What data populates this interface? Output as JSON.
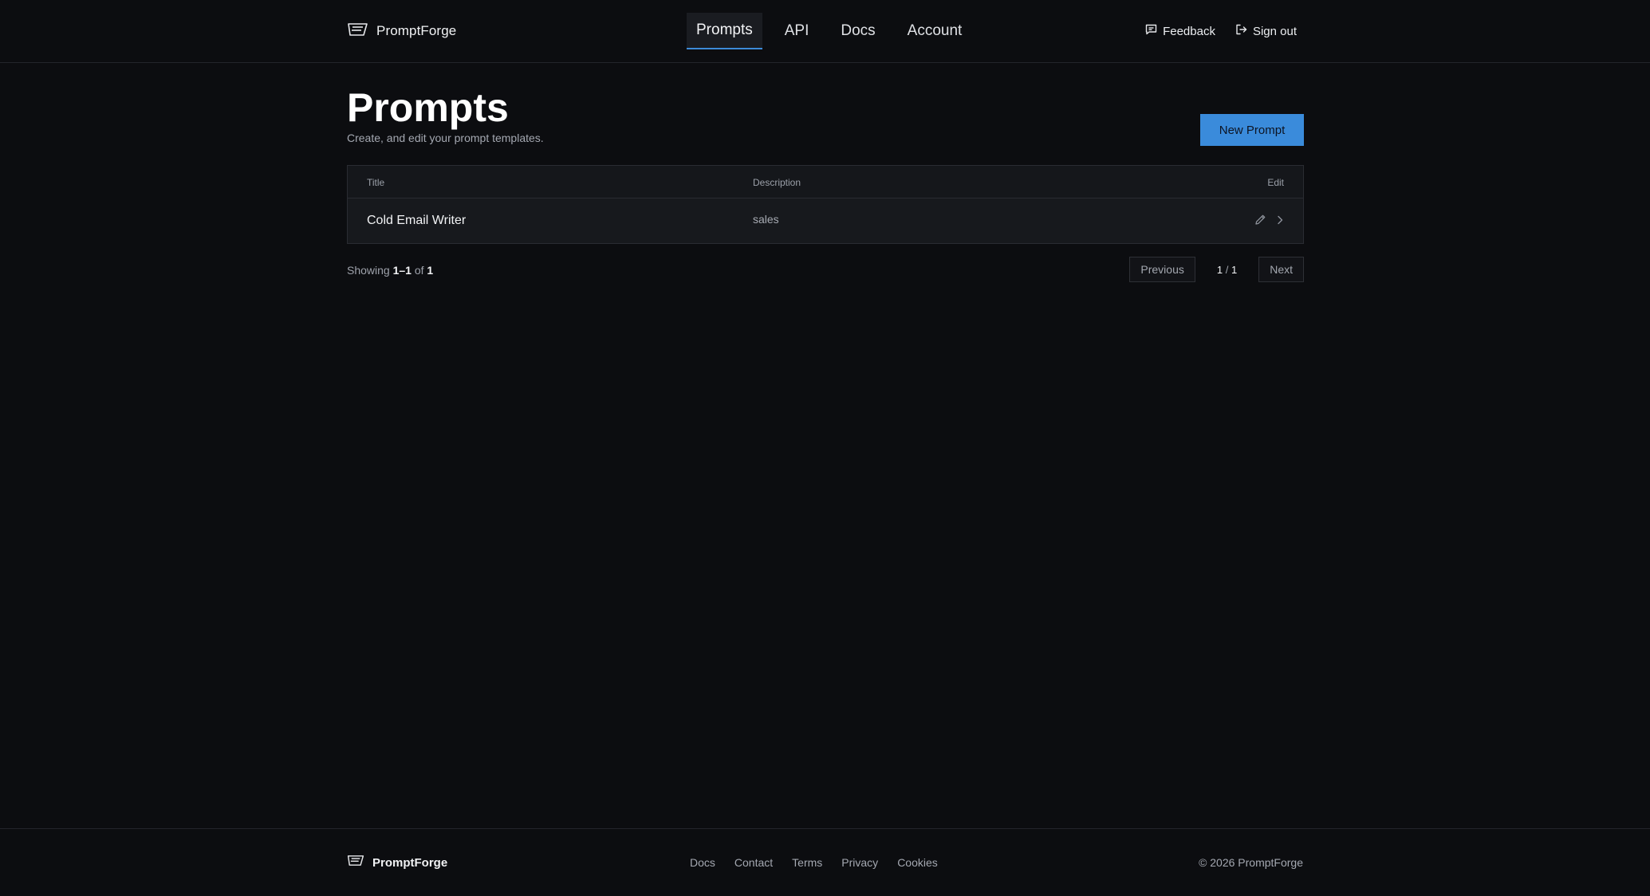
{
  "brand": {
    "name": "PromptForge",
    "icon": "forge-logo-icon"
  },
  "nav": {
    "items": [
      {
        "label": "Prompts",
        "active": true
      },
      {
        "label": "API",
        "active": false
      },
      {
        "label": "Docs",
        "active": false
      },
      {
        "label": "Account",
        "active": false
      }
    ]
  },
  "header_actions": {
    "feedback": {
      "label": "Feedback",
      "icon": "message-square-icon"
    },
    "signout": {
      "label": "Sign out",
      "icon": "log-out-icon"
    }
  },
  "page": {
    "title": "Prompts",
    "subtitle": "Create, and edit your prompt templates.",
    "new_button": "New Prompt"
  },
  "table": {
    "columns": {
      "title": "Title",
      "description": "Description",
      "edit": "Edit"
    },
    "rows": [
      {
        "title": "Cold Email Writer",
        "description": "sales"
      }
    ]
  },
  "pagination": {
    "showing_label": "Showing",
    "range": "1–1",
    "of_label": "of",
    "total": "1",
    "previous": "Previous",
    "next": "Next",
    "current_page": "1",
    "separator": "/",
    "page_count": "1"
  },
  "footer": {
    "brand": "PromptForge",
    "links": [
      "Docs",
      "Contact",
      "Terms",
      "Privacy",
      "Cookies"
    ],
    "copyright": "© 2026 PromptForge"
  },
  "colors": {
    "background": "#0c0d10",
    "accent": "#3a8bdb",
    "surface": "#15171b",
    "border": "#2a2c32"
  }
}
